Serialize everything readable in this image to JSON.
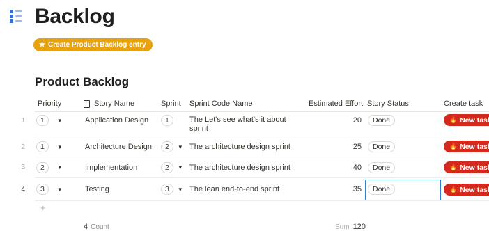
{
  "page": {
    "title": "Backlog",
    "icon": "list-icon"
  },
  "toolbar": {
    "create_label": "Create Product Backlog entry",
    "create_icon": "star-icon"
  },
  "section": {
    "title": "Product Backlog"
  },
  "table": {
    "columns": {
      "priority": "Priority",
      "story_name": "Story Name",
      "sprint": "Sprint",
      "sprint_code_name": "Sprint Code Name",
      "estimated_effort": "Estimated Effort",
      "story_status": "Story Status",
      "create_task": "Create task"
    },
    "rows": [
      {
        "num": "1",
        "priority": "1",
        "story_name": "Application Design",
        "sprint": "1",
        "sprint_code_name": "The Let's see what's it about sprint",
        "effort": "20",
        "status": "Done",
        "task_label": "New task"
      },
      {
        "num": "2",
        "priority": "1",
        "story_name": "Architecture Design",
        "sprint": "2",
        "sprint_code_name": "The architecture design sprint",
        "effort": "25",
        "status": "Done",
        "task_label": "New task"
      },
      {
        "num": "3",
        "priority": "2",
        "story_name": "Implementation",
        "sprint": "2",
        "sprint_code_name": "The architecture design sprint",
        "effort": "40",
        "status": "Done",
        "task_label": "New task"
      },
      {
        "num": "4",
        "priority": "3",
        "story_name": "Testing",
        "sprint": "3",
        "sprint_code_name": "The lean end-to-end sprint",
        "effort": "35",
        "status": "Done",
        "task_label": "New task"
      }
    ],
    "add_row": "+",
    "footer": {
      "count_value": "4",
      "count_label": "Count",
      "sum_label": "Sum",
      "sum_value": "120"
    }
  },
  "colors": {
    "create_button": "#e8a20c",
    "new_task_button": "#d42a1e",
    "focus_outline": "#2f7fd1",
    "icon_blue": "#2f6fe0"
  }
}
